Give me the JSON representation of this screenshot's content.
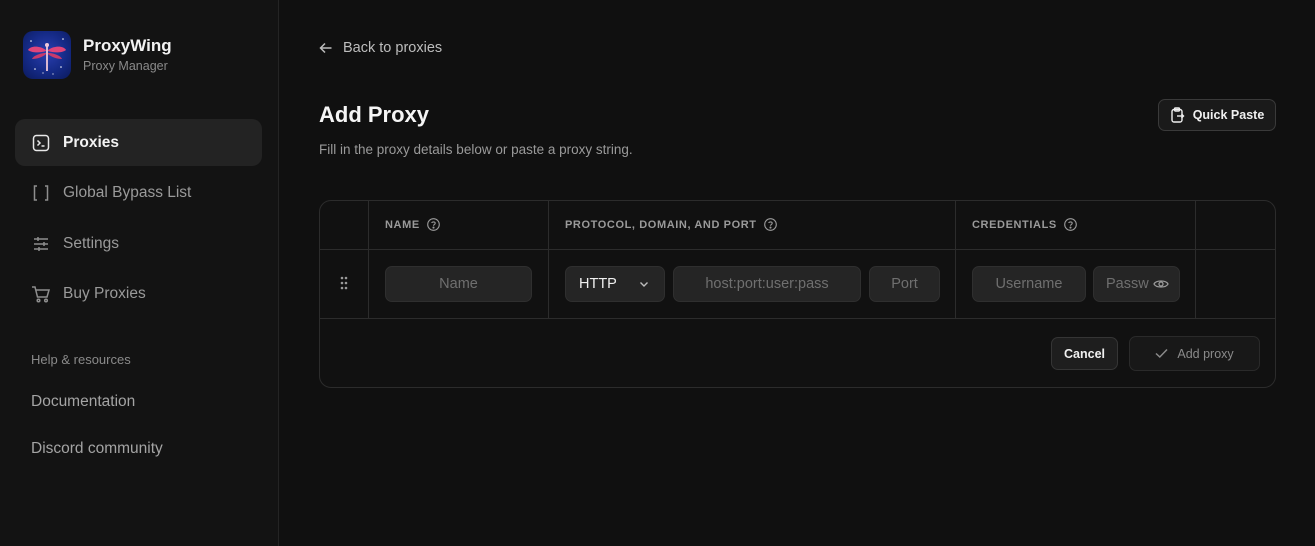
{
  "brand": {
    "name": "ProxyWing",
    "subtitle": "Proxy Manager"
  },
  "sidebar": {
    "items": [
      {
        "label": "Proxies",
        "icon": "terminal-icon",
        "active": true
      },
      {
        "label": "Global Bypass List",
        "icon": "brackets-icon",
        "active": false
      },
      {
        "label": "Settings",
        "icon": "sliders-icon",
        "active": false
      },
      {
        "label": "Buy Proxies",
        "icon": "cart-icon",
        "active": false
      }
    ],
    "resources_heading": "Help & resources",
    "resources": [
      {
        "label": "Documentation"
      },
      {
        "label": "Discord community"
      }
    ]
  },
  "main": {
    "back_label": "Back to proxies",
    "title": "Add Proxy",
    "subtitle": "Fill in the proxy details below or paste a proxy string.",
    "quick_paste_label": "Quick Paste"
  },
  "table": {
    "headers": {
      "name": "NAME",
      "protocol": "PROTOCOL, DOMAIN, AND PORT",
      "credentials": "CREDENTIALS"
    },
    "row": {
      "name_placeholder": "Name",
      "protocol_value": "HTTP",
      "host_placeholder": "host:port:user:pass",
      "port_placeholder": "Port",
      "username_placeholder": "Username",
      "password_placeholder": "Passw"
    },
    "cancel_label": "Cancel",
    "add_label": "Add proxy"
  },
  "colors": {
    "background": "#101010",
    "sidebar": "#131313",
    "active_nav": "#232323",
    "logo_blue": "#152a86",
    "logo_accent": "#e0457a"
  }
}
